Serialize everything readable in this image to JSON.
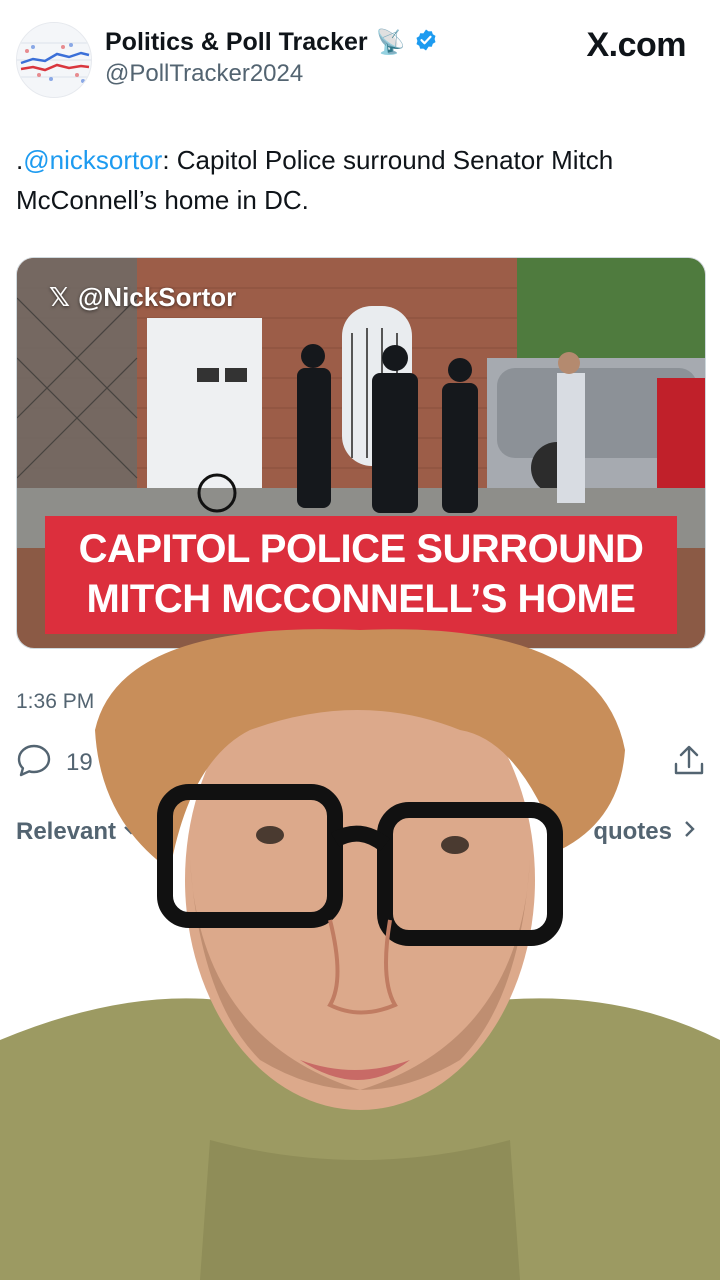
{
  "header": {
    "display_name": "Politics & Poll Tracker",
    "handle": "@PollTracker2024",
    "name_emoji": "📡",
    "verified_icon": "verified-badge-icon",
    "brand": "X.com"
  },
  "tweet": {
    "prefix": ".",
    "mention": "@nicksortor",
    "text": ": Capitol Police surround Senator Mitch McConnell’s home in DC.",
    "time": "1:36 PM",
    "reply_count": "19"
  },
  "media": {
    "watermark_handle": "@NickSortor",
    "banner_line1": "CAPITOL POLICE SURROUND",
    "banner_line2": "MITCH MCCONNELL’S HOME"
  },
  "replies_bar": {
    "sort_label": "Relevant",
    "quotes_label": "quotes"
  },
  "colors": {
    "accent": "#1d9bf0",
    "banner": "#dc2f3d",
    "muted": "#536471"
  }
}
